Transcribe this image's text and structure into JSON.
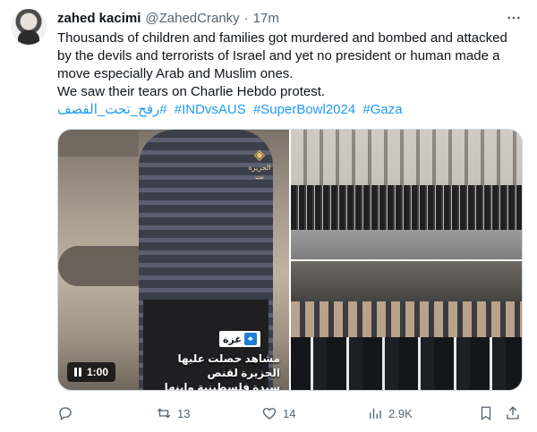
{
  "tweet": {
    "display_name": "zahed kacimi",
    "handle": "@ZahedCranky",
    "separator": "·",
    "time": "17m",
    "text_lines": [
      "Thousands of children and families got murdered and bombed and attacked",
      "by the devils and terrorists of Israel and yet no president or human made a",
      "move especially Arab and Muslim ones.",
      "We saw their tears on Charlie Hebdo protest."
    ],
    "hashtags": [
      "#رفح_تحت_القصف",
      "#INDvsAUS",
      "#SuperBowl2024",
      "#Gaza"
    ]
  },
  "media": {
    "video": {
      "logo_text": "الجزيرة نت",
      "location_label": "غزة",
      "caption_line1": "مشاهد حصلت عليها الجزيرة لقنص",
      "caption_line2": "سيدة فلسطينية وابنها",
      "duration": "1:00"
    }
  },
  "actions": {
    "reply_count": "",
    "retweet_count": "13",
    "like_count": "14",
    "views_count": "2.9K"
  },
  "icons": {
    "more": "more-dots-icon",
    "reply": "reply-icon",
    "retweet": "retweet-icon",
    "like": "heart-icon",
    "views": "views-icon",
    "bookmark": "bookmark-icon",
    "share": "share-icon",
    "pause": "pause-icon",
    "location": "location-pin-icon"
  },
  "colors": {
    "link": "#1d9bf0",
    "secondary_text": "#536471",
    "primary_text": "#0f1419"
  }
}
